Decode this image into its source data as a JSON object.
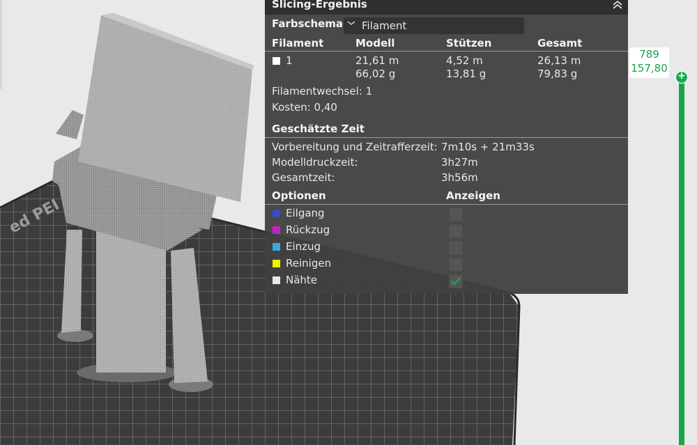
{
  "panel": {
    "title": "Slicing-Ergebnis",
    "color_scheme_label": "Farbschema",
    "color_scheme_value": "Filament",
    "columns": [
      "Filament",
      "Modell",
      "Stützen",
      "Gesamt"
    ],
    "filament_rows": [
      {
        "id": "1",
        "swatch_color": "#ffffff",
        "model_length": "21,61 m",
        "model_weight": "66,02 g",
        "support_length": "4,52 m",
        "support_weight": "13,81 g",
        "total_length": "26,13 m",
        "total_weight": "79,83 g"
      }
    ],
    "filament_changes": "Filamentwechsel:  1",
    "cost": "Kosten:  0,40",
    "time_section_title": "Geschätzte Zeit",
    "times": [
      {
        "label": "Vorbereitung und Zeitrafferzeit:",
        "value": "7m10s + 21m33s"
      },
      {
        "label": "Modelldruckzeit:",
        "value": "3h27m"
      },
      {
        "label": "Gesamtzeit:",
        "value": "3h56m"
      }
    ],
    "options_header": "Optionen",
    "show_header": "Anzeigen",
    "options": [
      {
        "label": "Eilgang",
        "color": "#3a4cc8",
        "checked": false
      },
      {
        "label": "Rückzug",
        "color": "#c81ed0",
        "checked": false
      },
      {
        "label": "Einzug",
        "color": "#3aa8d8",
        "checked": false
      },
      {
        "label": "Reinigen",
        "color": "#f0f000",
        "checked": false
      },
      {
        "label": "Nähte",
        "color": "#e8e8e8",
        "checked": true
      }
    ]
  },
  "layer_slider": {
    "layer": "789",
    "height": "157,80",
    "accent_color": "#18a54a"
  },
  "icons": [
    "collapse-up-icon",
    "chevron-down-icon",
    "checkmark-icon",
    "plus-icon"
  ]
}
